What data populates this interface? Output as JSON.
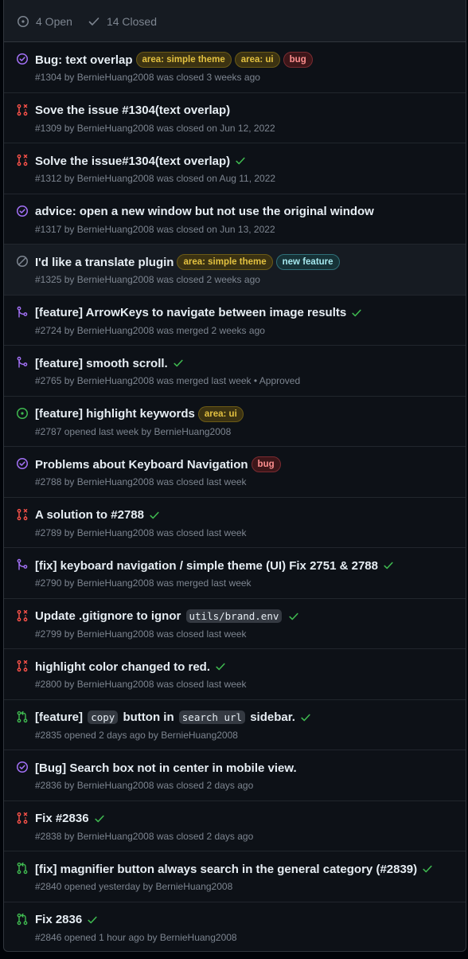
{
  "header": {
    "open_label": "4 Open",
    "closed_label": "14 Closed",
    "muted_color": "#7d8590"
  },
  "colors": {
    "open_issue": "#3fb950",
    "closed_completed": "#a371f7",
    "not_planned": "#7d8590",
    "pr_closed": "#f85149",
    "pr_merged": "#a371f7",
    "pr_open": "#3fb950",
    "check": "#3fb950"
  },
  "labels": {
    "area_simple_theme": {
      "text": "area: simple theme",
      "fg": "#e3c140",
      "bg": "#3b3212",
      "border": "#6b5a16"
    },
    "area_ui": {
      "text": "area: ui",
      "fg": "#e3c140",
      "bg": "#3b3212",
      "border": "#6b5a16"
    },
    "bug": {
      "text": "bug",
      "fg": "#ff8f8f",
      "bg": "#3d1619",
      "border": "#7a2b31"
    },
    "new_feature": {
      "text": "new feature",
      "fg": "#a5e8ee",
      "bg": "#163237",
      "border": "#2f6f78"
    }
  },
  "items": [
    {
      "icon": "issue-closed-icon",
      "state": "closed_completed",
      "parts": [
        {
          "t": "text",
          "v": "Bug: text overlap"
        }
      ],
      "labels": [
        "area_simple_theme",
        "area_ui",
        "bug"
      ],
      "check": false,
      "number": "#1304",
      "author": "BernieHuang2008",
      "status": "was closed 3 weeks ago",
      "format": "by"
    },
    {
      "icon": "pr-closed-icon",
      "state": "pr_closed",
      "parts": [
        {
          "t": "text",
          "v": "Sove the issue #1304(text overlap)"
        }
      ],
      "labels": [],
      "check": false,
      "number": "#1309",
      "author": "BernieHuang2008",
      "status": "was closed on Jun 12, 2022",
      "format": "by"
    },
    {
      "icon": "pr-closed-icon",
      "state": "pr_closed",
      "parts": [
        {
          "t": "text",
          "v": "Solve the issue#1304(text overlap)"
        }
      ],
      "labels": [],
      "check": true,
      "number": "#1312",
      "author": "BernieHuang2008",
      "status": "was closed on Aug 11, 2022",
      "format": "by"
    },
    {
      "icon": "issue-closed-icon",
      "state": "closed_completed",
      "parts": [
        {
          "t": "text",
          "v": "advice: open a new window but not use the original window"
        }
      ],
      "labels": [],
      "check": false,
      "number": "#1317",
      "author": "BernieHuang2008",
      "status": "was closed on Jun 13, 2022",
      "format": "by"
    },
    {
      "icon": "issue-not-planned-icon",
      "state": "not_planned",
      "parts": [
        {
          "t": "text",
          "v": "I'd like a translate plugin"
        }
      ],
      "labels": [
        "area_simple_theme",
        "new_feature"
      ],
      "check": false,
      "number": "#1325",
      "author": "BernieHuang2008",
      "status": "was closed 2 weeks ago",
      "format": "by",
      "highlighted": true
    },
    {
      "icon": "pr-merged-icon",
      "state": "pr_merged",
      "parts": [
        {
          "t": "text",
          "v": "[feature] ArrowKeys to navigate between image results"
        }
      ],
      "labels": [],
      "check": true,
      "number": "#2724",
      "author": "BernieHuang2008",
      "status": "was merged 2 weeks ago",
      "format": "by"
    },
    {
      "icon": "pr-merged-icon",
      "state": "pr_merged",
      "parts": [
        {
          "t": "text",
          "v": "[feature] smooth scroll."
        }
      ],
      "labels": [],
      "check": true,
      "number": "#2765",
      "author": "BernieHuang2008",
      "status": "was merged last week • Approved",
      "format": "by"
    },
    {
      "icon": "issue-open-icon",
      "state": "open_issue",
      "parts": [
        {
          "t": "text",
          "v": "[feature] highlight keywords"
        }
      ],
      "labels": [
        "area_ui"
      ],
      "check": false,
      "number": "#2787",
      "author": "BernieHuang2008",
      "status": "opened last week",
      "format": "opened"
    },
    {
      "icon": "issue-closed-icon",
      "state": "closed_completed",
      "parts": [
        {
          "t": "text",
          "v": "Problems about Keyboard Navigation"
        }
      ],
      "labels": [
        "bug"
      ],
      "check": false,
      "number": "#2788",
      "author": "BernieHuang2008",
      "status": "was closed last week",
      "format": "by"
    },
    {
      "icon": "pr-closed-icon",
      "state": "pr_closed",
      "parts": [
        {
          "t": "text",
          "v": "A solution to #2788"
        }
      ],
      "labels": [],
      "check": true,
      "number": "#2789",
      "author": "BernieHuang2008",
      "status": "was closed last week",
      "format": "by"
    },
    {
      "icon": "pr-merged-icon",
      "state": "pr_merged",
      "parts": [
        {
          "t": "text",
          "v": "[fix] keyboard navigation / simple theme (UI) Fix 2751 & 2788"
        }
      ],
      "labels": [],
      "check": true,
      "number": "#2790",
      "author": "BernieHuang2008",
      "status": "was merged last week",
      "format": "by"
    },
    {
      "icon": "pr-closed-icon",
      "state": "pr_closed",
      "parts": [
        {
          "t": "text",
          "v": "Update .gitignore to ignor "
        },
        {
          "t": "code",
          "v": "utils/brand.env"
        }
      ],
      "labels": [],
      "check": true,
      "number": "#2799",
      "author": "BernieHuang2008",
      "status": "was closed last week",
      "format": "by"
    },
    {
      "icon": "pr-closed-icon",
      "state": "pr_closed",
      "parts": [
        {
          "t": "text",
          "v": "highlight color changed to red."
        }
      ],
      "labels": [],
      "check": true,
      "number": "#2800",
      "author": "BernieHuang2008",
      "status": "was closed last week",
      "format": "by"
    },
    {
      "icon": "pr-open-icon",
      "state": "pr_open",
      "parts": [
        {
          "t": "text",
          "v": "[feature] "
        },
        {
          "t": "code",
          "v": "copy"
        },
        {
          "t": "text",
          "v": " button in "
        },
        {
          "t": "code",
          "v": "search url"
        },
        {
          "t": "text",
          "v": " sidebar."
        }
      ],
      "labels": [],
      "check": true,
      "number": "#2835",
      "author": "BernieHuang2008",
      "status": "opened 2 days ago",
      "format": "opened"
    },
    {
      "icon": "issue-closed-icon",
      "state": "closed_completed",
      "parts": [
        {
          "t": "text",
          "v": "[Bug] Search box not in center in mobile view."
        }
      ],
      "labels": [],
      "check": false,
      "number": "#2836",
      "author": "BernieHuang2008",
      "status": "was closed 2 days ago",
      "format": "by"
    },
    {
      "icon": "pr-closed-icon",
      "state": "pr_closed",
      "parts": [
        {
          "t": "text",
          "v": "Fix #2836"
        }
      ],
      "labels": [],
      "check": true,
      "number": "#2838",
      "author": "BernieHuang2008",
      "status": "was closed 2 days ago",
      "format": "by"
    },
    {
      "icon": "pr-open-icon",
      "state": "pr_open",
      "parts": [
        {
          "t": "text",
          "v": "[fix] magnifier button always search in the general category (#2839)"
        }
      ],
      "labels": [],
      "check": true,
      "number": "#2840",
      "author": "BernieHuang2008",
      "status": "opened yesterday",
      "format": "opened"
    },
    {
      "icon": "pr-open-icon",
      "state": "pr_open",
      "parts": [
        {
          "t": "text",
          "v": "Fix 2836"
        }
      ],
      "labels": [],
      "check": true,
      "number": "#2846",
      "author": "BernieHuang2008",
      "status": "opened 1 hour ago",
      "format": "opened"
    }
  ],
  "meta_words": {
    "by": "by"
  }
}
